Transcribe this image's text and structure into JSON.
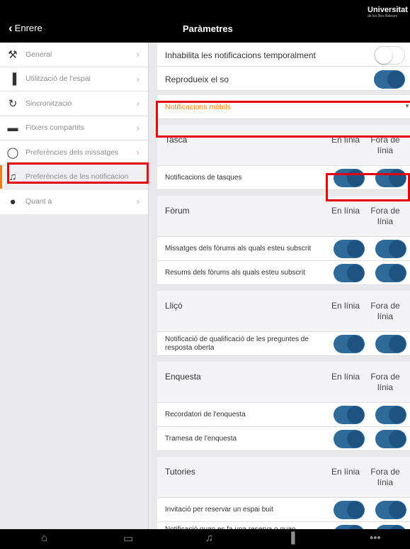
{
  "header": {
    "back_label": "Enrere",
    "title": "Paràmetres",
    "logo_line1": "Universitat",
    "logo_line2": "de les Illes Balears"
  },
  "sidebar": {
    "items": [
      {
        "label": "General",
        "icon": "wrench-icon",
        "glyph": "⚒"
      },
      {
        "label": "Utilització de l'espai",
        "icon": "bar-chart-icon",
        "glyph": "▐"
      },
      {
        "label": "Sincronització",
        "icon": "sync-icon",
        "glyph": "↻"
      },
      {
        "label": "Fitxers compartits",
        "icon": "folder-icon",
        "glyph": "▬"
      },
      {
        "label": "Preferències dels missatges",
        "icon": "chat-icon",
        "glyph": "◯"
      },
      {
        "label": "Preferències de les notificacions",
        "icon": "bell-icon",
        "glyph": "♫"
      },
      {
        "label": "Quant a",
        "icon": "about-icon",
        "glyph": "●"
      }
    ]
  },
  "settings": {
    "disable_notifications_label": "Inhabilita les notificacions temporalment",
    "disable_notifications_on": false,
    "play_sound_label": "Reprodueix el so",
    "play_sound_on": true,
    "processor_select": "Notificacions mòbils"
  },
  "columns": {
    "online": "En línia",
    "offline": "Fora de línia"
  },
  "groups": [
    {
      "name": "Tasca",
      "items": [
        {
          "label": "Notificacions de tasques",
          "online": true,
          "offline": true
        }
      ]
    },
    {
      "name": "Fòrum",
      "items": [
        {
          "label": "Missatges dels fòrums als quals esteu subscrit",
          "online": true,
          "offline": true
        },
        {
          "label": "Resums dels fòrums als quals esteu subscrit",
          "online": true,
          "offline": true
        }
      ]
    },
    {
      "name": "Lliçó",
      "items": [
        {
          "label": "Notificació de qualificació de les preguntes de resposta oberta",
          "online": true,
          "offline": true
        }
      ]
    },
    {
      "name": "Enquesta",
      "items": [
        {
          "label": "Recordatori de l'enquesta",
          "online": true,
          "offline": true
        },
        {
          "label": "Tramesa de l'enquesta",
          "online": true,
          "offline": true
        }
      ]
    },
    {
      "name": "Tutories",
      "items": [
        {
          "label": "Invitació per reservar un espai buit",
          "online": true,
          "offline": true
        },
        {
          "label": "Notificació quan es fa una reserva o quan aquesta es cancel·la",
          "online": true,
          "offline": true
        }
      ]
    }
  ],
  "tabbar": {
    "items": [
      {
        "name": "home-icon",
        "glyph": "⌂"
      },
      {
        "name": "calendar-icon",
        "glyph": "▭"
      },
      {
        "name": "bell-icon",
        "glyph": "♫"
      },
      {
        "name": "grades-icon",
        "glyph": "▐"
      },
      {
        "name": "more-icon",
        "glyph": "•••"
      }
    ]
  },
  "colors": {
    "accent": "#f98012",
    "toggle_on": "#2f6b9a",
    "highlight": "#e3000f"
  }
}
